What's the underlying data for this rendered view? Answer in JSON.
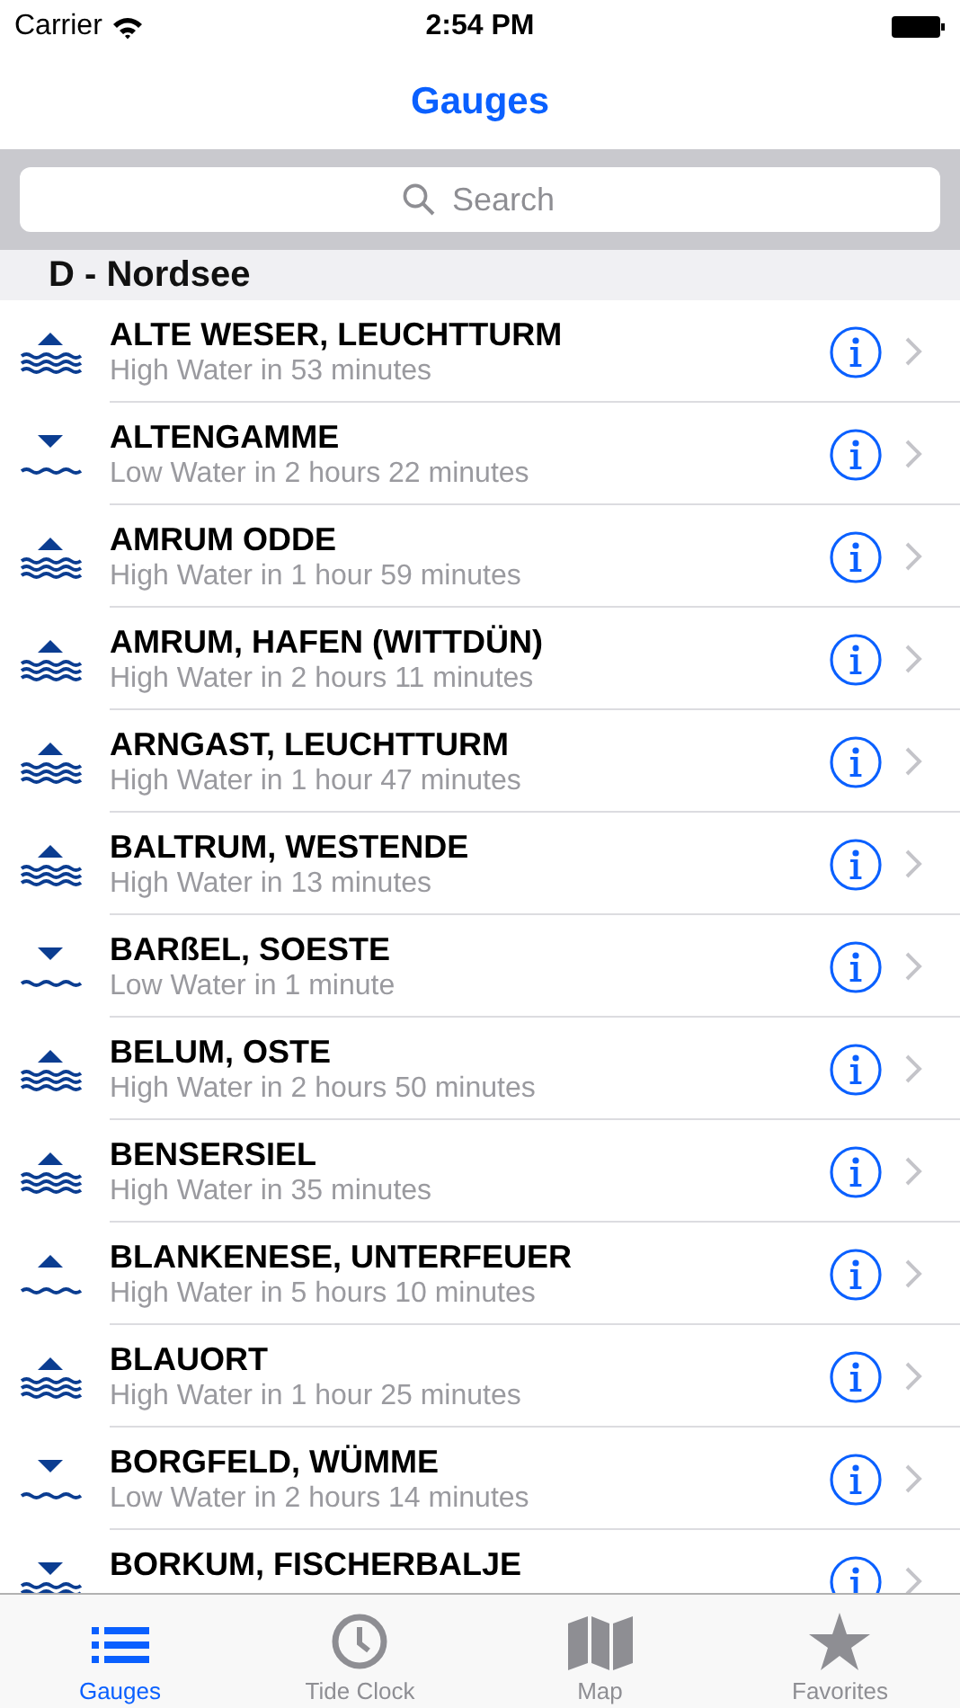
{
  "status_bar": {
    "carrier": "Carrier",
    "time": "2:54 PM"
  },
  "nav": {
    "title": "Gauges"
  },
  "search": {
    "placeholder": "Search"
  },
  "section": {
    "title": "D - Nordsee"
  },
  "rows": [
    {
      "name": "ALTE WESER, LEUCHTTURM",
      "detail": "High Water in 53 minutes",
      "kind": "rising",
      "rough": true
    },
    {
      "name": "ALTENGAMME",
      "detail": "Low Water in 2 hours 22 minutes",
      "kind": "falling",
      "rough": false
    },
    {
      "name": "AMRUM ODDE",
      "detail": "High Water in 1 hour 59 minutes",
      "kind": "rising",
      "rough": true
    },
    {
      "name": "AMRUM, HAFEN (WITTDÜN)",
      "detail": "High Water in 2 hours 11 minutes",
      "kind": "rising",
      "rough": true
    },
    {
      "name": "ARNGAST, LEUCHTTURM",
      "detail": "High Water in 1 hour 47 minutes",
      "kind": "rising",
      "rough": true
    },
    {
      "name": "BALTRUM, WESTENDE",
      "detail": "High Water in 13 minutes",
      "kind": "rising",
      "rough": true
    },
    {
      "name": "BARßEL, SOESTE",
      "detail": "Low Water in 1 minute",
      "kind": "falling",
      "rough": false
    },
    {
      "name": "BELUM, OSTE",
      "detail": "High Water in 2 hours 50 minutes",
      "kind": "rising",
      "rough": true
    },
    {
      "name": "BENSERSIEL",
      "detail": "High Water in 35 minutes",
      "kind": "rising",
      "rough": true
    },
    {
      "name": "BLANKENESE, UNTERFEUER",
      "detail": "High Water in 5 hours 10 minutes",
      "kind": "rising",
      "rough": false
    },
    {
      "name": "BLAUORT",
      "detail": "High Water in 1 hour 25 minutes",
      "kind": "rising",
      "rough": true
    },
    {
      "name": "BORGFELD, WÜMME",
      "detail": "Low Water in 2 hours 14 minutes",
      "kind": "falling",
      "rough": false
    },
    {
      "name": "BORKUM, FISCHERBALJE",
      "kind": "falling",
      "rough": true
    }
  ],
  "tabs": [
    {
      "label": "Gauges",
      "selected": true
    },
    {
      "label": "Tide Clock",
      "selected": false
    },
    {
      "label": "Map",
      "selected": false
    },
    {
      "label": "Favorites",
      "selected": false
    }
  ]
}
